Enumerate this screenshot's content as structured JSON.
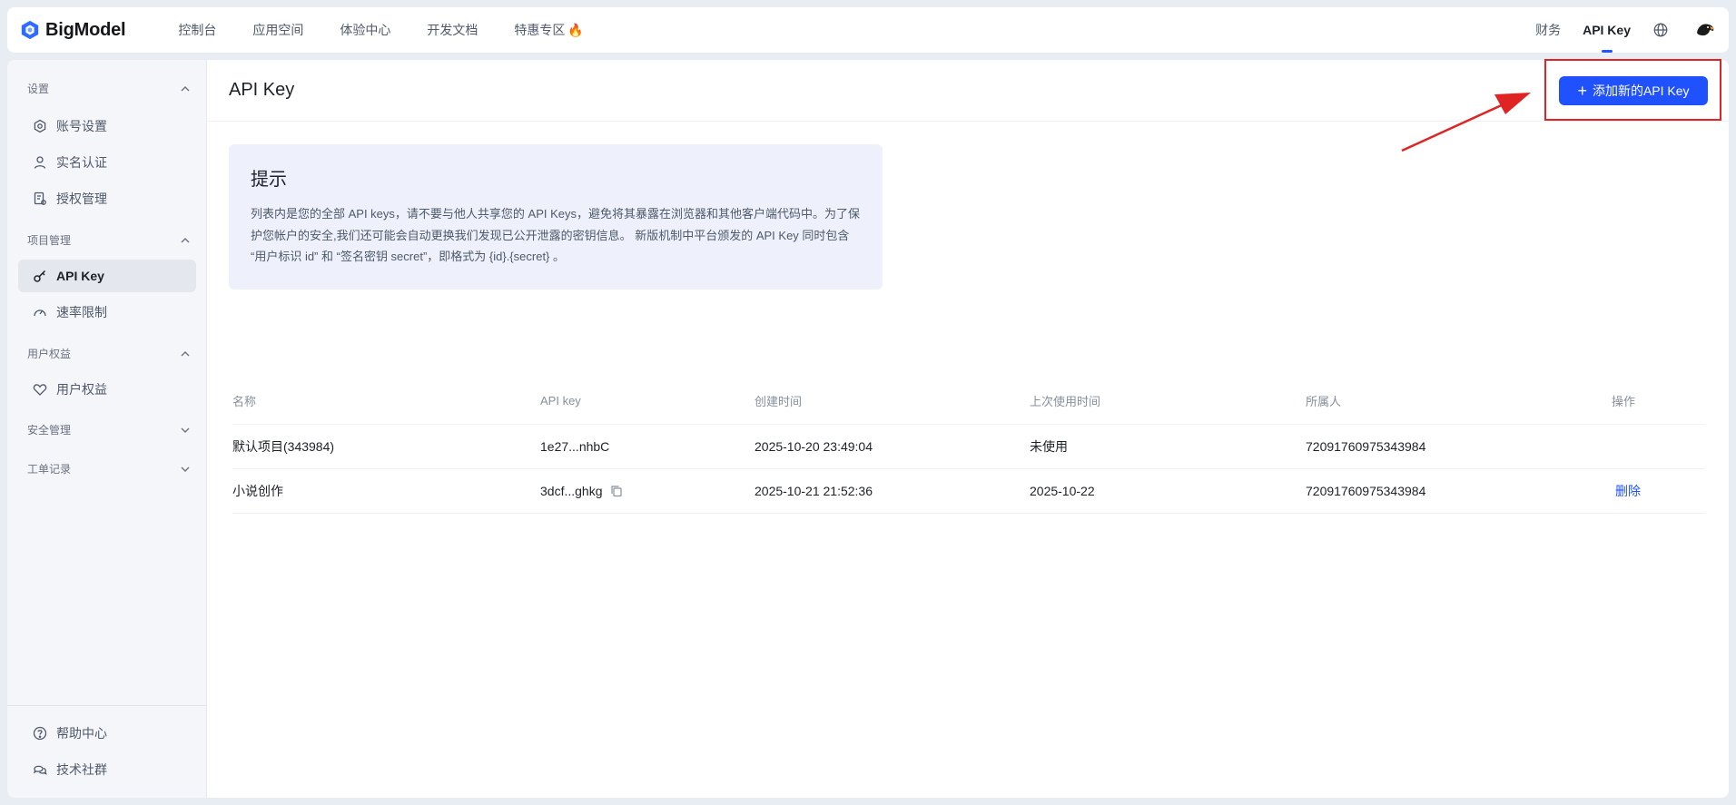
{
  "brand": {
    "name": "BigModel",
    "accent": "#1f51ff",
    "highlight": "#e02424"
  },
  "nav": {
    "items": [
      "控制台",
      "应用空间",
      "体验中心",
      "开发文档",
      "特惠专区"
    ],
    "fire_glyph": "🔥",
    "right": {
      "finance": "财务",
      "api_key": "API Key"
    }
  },
  "sidebar": {
    "groups": [
      {
        "title": "设置",
        "items": [
          "账号设置",
          "实名认证",
          "授权管理"
        ]
      },
      {
        "title": "项目管理",
        "items": [
          "API Key",
          "速率限制"
        ]
      },
      {
        "title": "用户权益",
        "items": [
          "用户权益"
        ]
      },
      {
        "title": "安全管理",
        "items": []
      },
      {
        "title": "工单记录",
        "items": []
      }
    ],
    "footer": [
      "帮助中心",
      "技术社群"
    ]
  },
  "main": {
    "title": "API Key",
    "add_button": "添加新的API Key",
    "tip": {
      "title": "提示",
      "body": "列表内是您的全部 API keys，请不要与他人共享您的 API Keys，避免将其暴露在浏览器和其他客户端代码中。为了保护您帐户的安全,我们还可能会自动更换我们发现已公开泄露的密钥信息。 新版机制中平台颁发的 API Key 同时包含 “用户标识 id” 和 “签名密钥 secret”，即格式为 {id}.{secret} 。"
    },
    "table": {
      "columns": [
        "名称",
        "API key",
        "创建时间",
        "上次使用时间",
        "所属人",
        "操作"
      ],
      "rows": [
        {
          "name": "默认项目(343984)",
          "key": "1e27...nhbC",
          "created": "2025-10-20 23:49:04",
          "last_used": "未使用",
          "owner": "72091760975343984",
          "action": ""
        },
        {
          "name": "小说创作",
          "key": "3dcf...ghkg",
          "created": "2025-10-21 21:52:36",
          "last_used": "2025-10-22",
          "owner": "72091760975343984",
          "action": "删除"
        }
      ]
    }
  }
}
